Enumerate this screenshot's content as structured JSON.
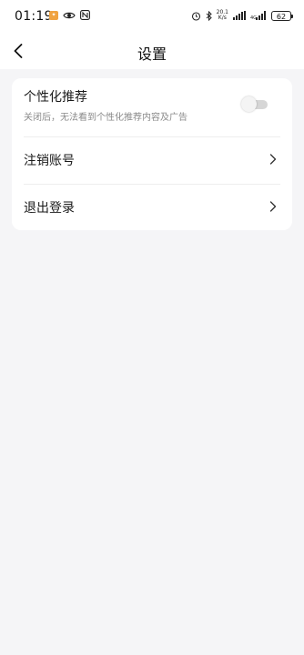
{
  "status_bar": {
    "time": "01:19",
    "net_speed_top": "20.1",
    "net_speed_bottom": "K/s",
    "battery": "62"
  },
  "nav": {
    "title": "设置"
  },
  "settings": {
    "personalized": {
      "title": "个性化推荐",
      "subtitle": "关闭后，无法看到个性化推荐内容及广告",
      "enabled": false
    },
    "cancel_account": {
      "label": "注销账号"
    },
    "logout": {
      "label": "退出登录"
    }
  },
  "colors": {
    "page_bg": "#f5f5f7",
    "card_bg": "#ffffff",
    "toggle_off": "#d6d6d6"
  }
}
